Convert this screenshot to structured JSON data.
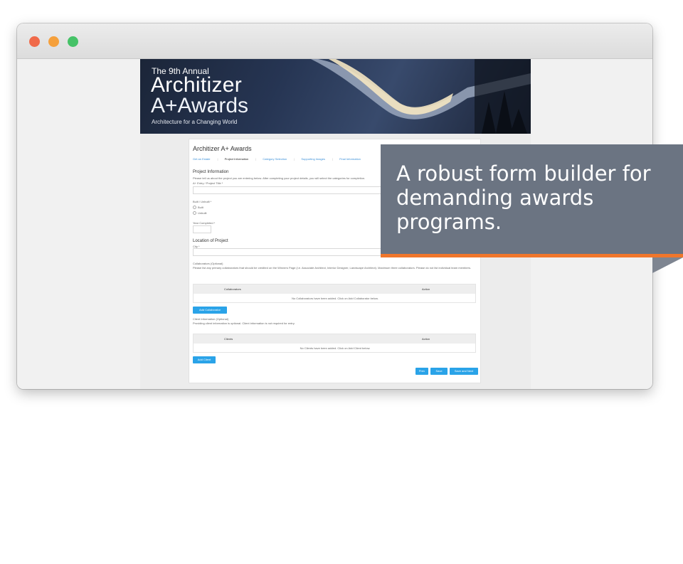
{
  "banner": {
    "annual": "The 9th Annual",
    "title": "Architizer",
    "awards": "A+Awards",
    "tagline": "Architecture for a Changing World"
  },
  "form": {
    "title": "Architizer A+ Awards",
    "steps": [
      "Get an Estate",
      "Project Information",
      "Category Selection",
      "Supporting Images",
      "Final Information"
    ],
    "active_step": 1,
    "project_info": {
      "heading": "Project Information",
      "description": "Please tell us about the project you are entering below. After completing your project details, you will select the categories for completion.",
      "title_label": "A+ Entry / Project Title *",
      "built_label": "Built / Unbuilt *",
      "built_option": "Built",
      "unbuilt_option": "Unbuilt",
      "year_label": "Year Completed *"
    },
    "location": {
      "heading": "Location of Project",
      "city_label": "City *"
    },
    "collaborators": {
      "heading": "Collaborators (Optional)",
      "description": "Please list any primary collaborators that should be credited on the Winners Page (i.e. Associate Architect, Interior Designer, Landscape Architect). Maximum three collaborators. Please do not list individual team members.",
      "col_name": "Collaborators",
      "col_action": "Action",
      "empty": "No Collaborators have been added. Click on Add Collaborator below.",
      "add_button": "Add Collaborator"
    },
    "clients": {
      "heading": "Client Information (Optional)",
      "description": "Providing client information is optional. Client information is not required for entry.",
      "col_name": "Clients",
      "col_action": "Action",
      "empty": "No Clients have been added. Click on Add Client below.",
      "add_button": "Add Client"
    },
    "footer": {
      "prev": "Prev",
      "save": "Save",
      "save_next": "Save and Next"
    }
  },
  "callout": {
    "text": "A robust form builder for demanding awards programs.",
    "background": "#6b7482",
    "accent": "#f0762b"
  },
  "colors": {
    "close": "#f06a4a",
    "minimize": "#f5a03c",
    "maximize": "#45c267",
    "button": "#2aa3e8"
  }
}
